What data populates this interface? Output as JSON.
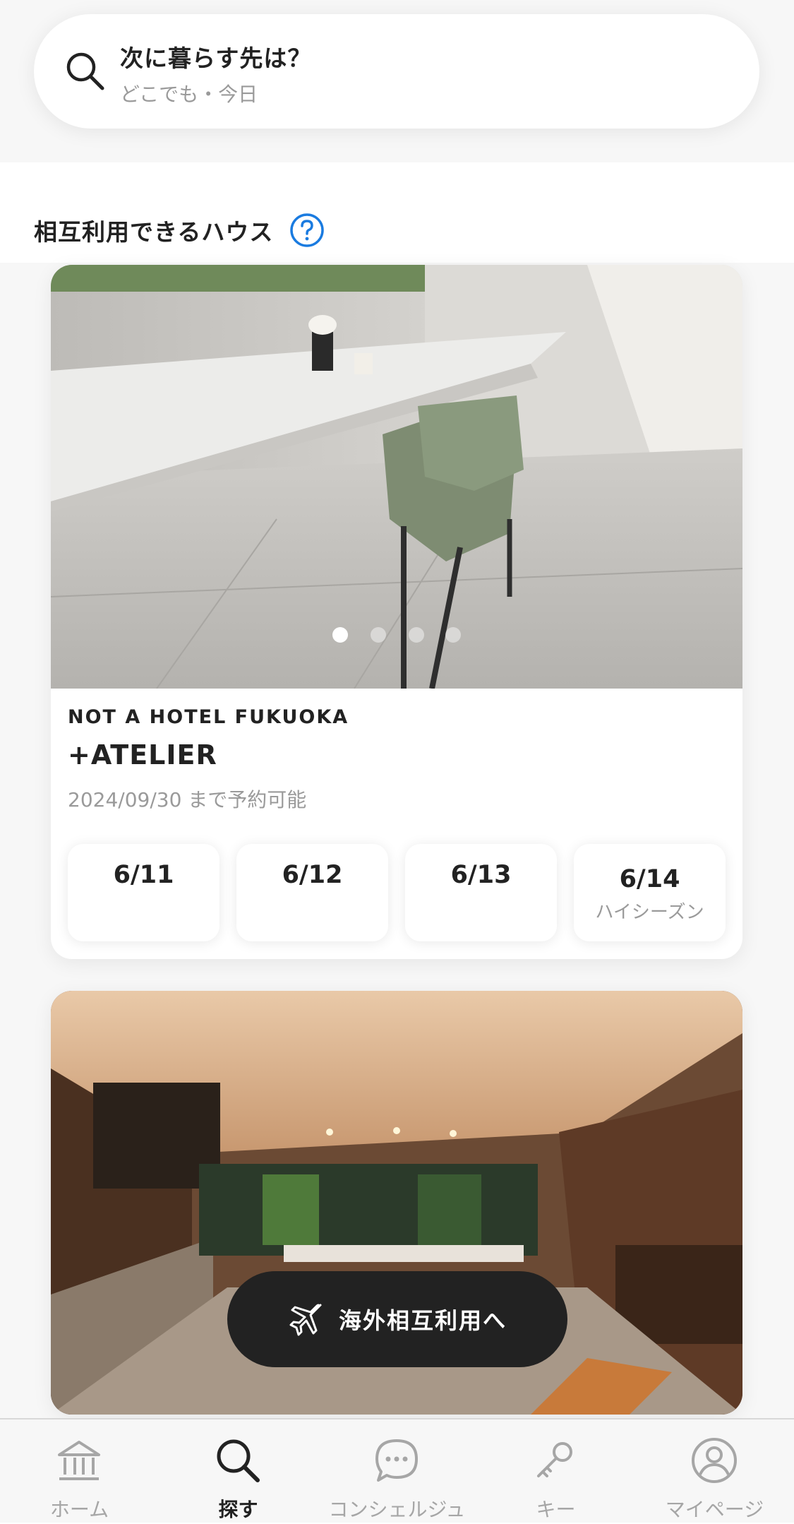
{
  "search": {
    "title": "次に暮らす先は？",
    "subtitle": "どこでも・今日"
  },
  "section": {
    "title": "相互利用できるハウス"
  },
  "carousel": {
    "count": 4,
    "active_index": 0
  },
  "listings": [
    {
      "brand": "NOT A HOTEL FUKUOKA",
      "name": "+ATELIER",
      "availability": "2024/09/30 まで予約可能",
      "dates": [
        {
          "date": "6/11",
          "tag": ""
        },
        {
          "date": "6/12",
          "tag": ""
        },
        {
          "date": "6/13",
          "tag": ""
        },
        {
          "date": "6/14",
          "tag": "ハイシーズン"
        }
      ]
    }
  ],
  "fab": {
    "label": "海外相互利用へ",
    "icon": "airplane-icon"
  },
  "tabbar": {
    "items": [
      {
        "label": "ホーム",
        "icon": "home-icon",
        "active": false
      },
      {
        "label": "探す",
        "icon": "search-icon",
        "active": true
      },
      {
        "label": "コンシェルジュ",
        "icon": "chat-icon",
        "active": false
      },
      {
        "label": "キー",
        "icon": "key-icon",
        "active": false
      },
      {
        "label": "マイページ",
        "icon": "user-icon",
        "active": false
      }
    ]
  },
  "colors": {
    "accent_blue": "#1a7be0",
    "fab_bg": "#222222",
    "muted_text": "#9a9a9a"
  }
}
